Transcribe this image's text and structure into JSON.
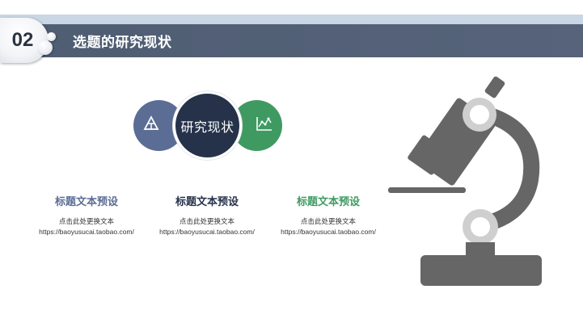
{
  "header": {
    "number": "02",
    "title": "选题的研究现状"
  },
  "center_circle": {
    "label": "研究现状"
  },
  "left_circle": {
    "icon": "triangle-network-icon",
    "color": "#5b6d94"
  },
  "right_circle": {
    "icon": "line-chart-icon",
    "color": "#3f9a62"
  },
  "columns": [
    {
      "title": "标题文本预设",
      "line1": "点击此处更换文本",
      "line2": "https://baoyusucai.taobao.com/",
      "color": "#5b6d94"
    },
    {
      "title": "标题文本预设",
      "line1": "点击此处更换文本",
      "line2": "https://baoyusucai.taobao.com/",
      "color": "#25324a"
    },
    {
      "title": "标题文本预设",
      "line1": "点击此处更换文本",
      "line2": "https://baoyusucai.taobao.com/",
      "color": "#3f9a62"
    }
  ],
  "decoration": {
    "image": "microscope-icon",
    "color": "#666666"
  }
}
